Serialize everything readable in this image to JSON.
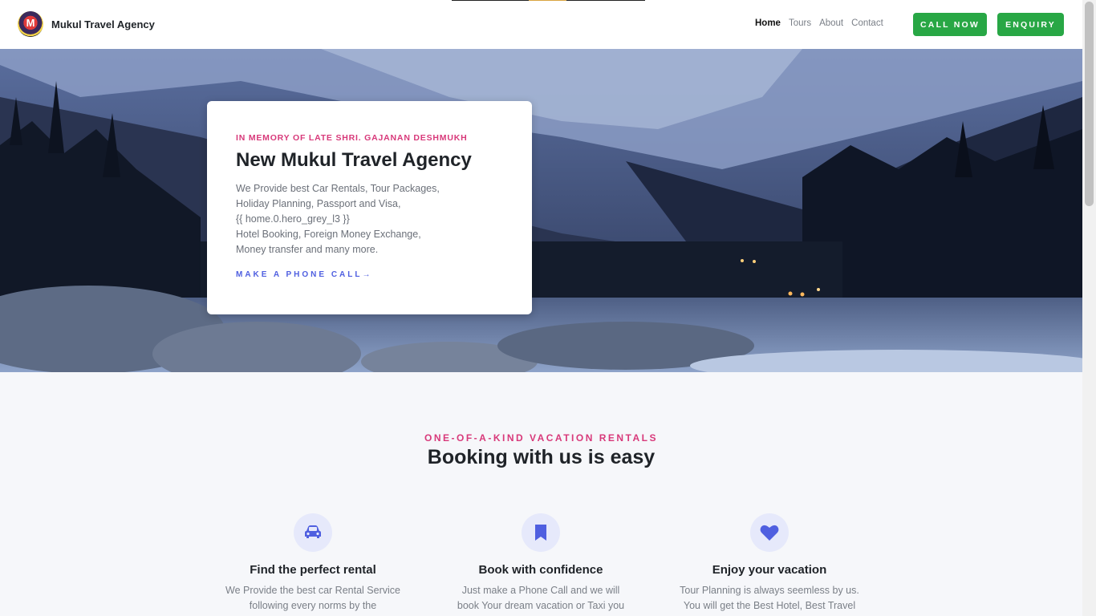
{
  "brand": {
    "name": "Mukul Travel Agency",
    "logo_letter": "M"
  },
  "nav": {
    "links": [
      "Home",
      "Tours",
      "About",
      "Contact"
    ],
    "active": "Home",
    "call_now": "CALL NOW",
    "enquiry": "ENQUIRY"
  },
  "hero": {
    "eyebrow": "IN MEMORY OF LATE SHRI. GAJANAN DESHMUKH",
    "title": "New Mukul Travel Agency",
    "desc_lines": [
      "We Provide best Car Rentals, Tour Packages,",
      "Holiday Planning, Passport and Visa,",
      "{{ home.0.hero_grey_l3 }}",
      "Hotel Booking, Foreign Money Exchange,",
      "Money transfer and many more."
    ],
    "cta": "MAKE A PHONE CALL→"
  },
  "booking": {
    "eyebrow": "ONE-OF-A-KIND VACATION RENTALS",
    "title": "Booking with us is easy",
    "features": [
      {
        "icon": "car-icon",
        "title": "Find the perfect rental",
        "text_lines": [
          "We Provide the best car Rental Service",
          "following every norms by the"
        ]
      },
      {
        "icon": "bookmark-icon",
        "title": "Book with confidence",
        "text_lines": [
          "Just make a Phone Call and we will",
          "book Your dream vacation or Taxi you"
        ]
      },
      {
        "icon": "heart-icon",
        "title": "Enjoy your vacation",
        "text_lines": [
          "Tour Planning is always seemless by us.",
          "You will get the Best Hotel, Best Travel"
        ]
      }
    ]
  },
  "colors": {
    "accent_pink": "#d8397a",
    "accent_blue": "#4f5fe0",
    "button_green": "#28a745"
  }
}
